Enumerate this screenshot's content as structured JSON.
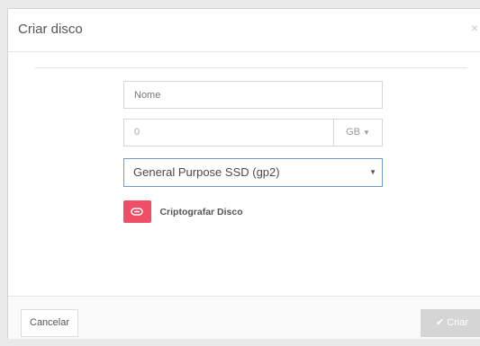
{
  "modal": {
    "title": "Criar disco",
    "close_symbol": "×"
  },
  "form": {
    "name_placeholder": "Nome",
    "size_value": "0",
    "size_unit": "GB",
    "volume_type": "General Purpose SSD (gp2)",
    "encrypt_label": "Criptografar Disco",
    "encrypt_enabled": true
  },
  "footer": {
    "cancel_label": "Cancelar",
    "create_label": "Criar"
  },
  "colors": {
    "toggle_accent": "#ee4f66",
    "select_border": "#6f9ad2",
    "create_disabled": "#d5d5d5"
  },
  "icons": {
    "close": "close-icon",
    "dropdown": "caret-down-icon",
    "toggle": "link-toggle-icon",
    "create": "check-icon"
  }
}
